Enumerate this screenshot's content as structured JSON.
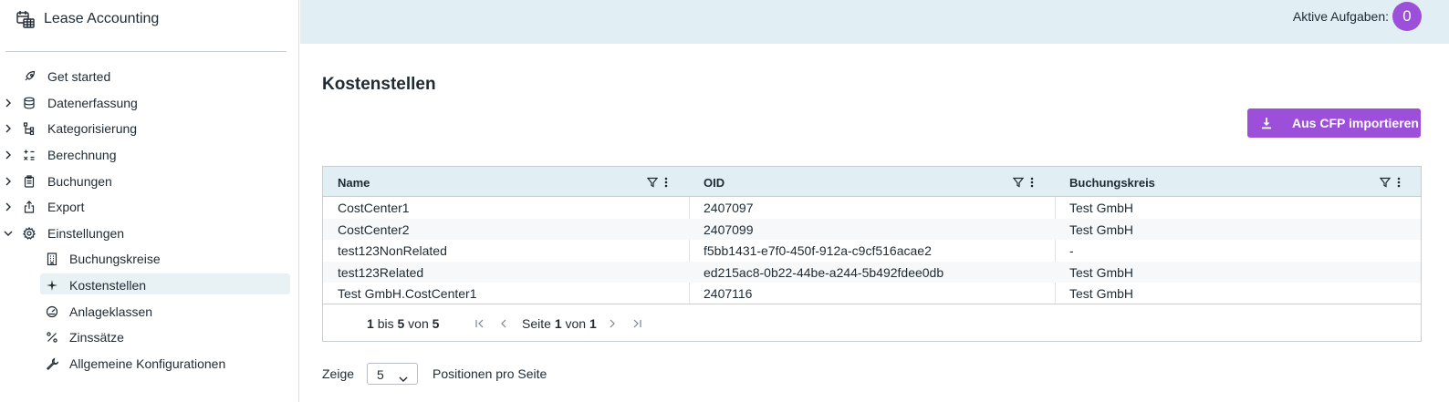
{
  "app": {
    "title": "Lease Accounting"
  },
  "sidebar": {
    "items": [
      {
        "label": "Get started",
        "icon": "rocket-icon"
      },
      {
        "label": "Datenerfassung",
        "icon": "database-icon"
      },
      {
        "label": "Kategorisierung",
        "icon": "hierarchy-icon"
      },
      {
        "label": "Berechnung",
        "icon": "calculator-icon"
      },
      {
        "label": "Buchungen",
        "icon": "clipboard-icon"
      },
      {
        "label": "Export",
        "icon": "export-icon"
      },
      {
        "label": "Einstellungen",
        "icon": "gear-icon"
      }
    ],
    "subitems": [
      {
        "label": "Buchungskreise",
        "icon": "building-icon"
      },
      {
        "label": "Kostenstellen",
        "icon": "sparkle-icon"
      },
      {
        "label": "Anlageklassen",
        "icon": "gauge-icon"
      },
      {
        "label": "Zinssätze",
        "icon": "percent-icon"
      },
      {
        "label": "Allgemeine Konfigurationen",
        "icon": "wrench-icon"
      }
    ]
  },
  "topbar": {
    "tasks_label": "Aktive Aufgaben:",
    "tasks_count": "0"
  },
  "page": {
    "title": "Kostenstellen",
    "import_label": "Aus CFP importieren"
  },
  "table": {
    "columns": [
      "Name",
      "OID",
      "Buchungskreis"
    ],
    "rows": [
      [
        "CostCenter1",
        "2407097",
        "Test GmbH"
      ],
      [
        "CostCenter2",
        "2407099",
        "Test GmbH"
      ],
      [
        "test123NonRelated",
        "f5bb1431-e7f0-450f-912a-c9cf516acae2",
        "-"
      ],
      [
        "test123Related",
        "ed215ac8-0b22-44be-a244-5b492fdee0db",
        "Test GmbH"
      ],
      [
        "Test GmbH.CostCenter1",
        "2407116",
        "Test GmbH"
      ]
    ]
  },
  "pager": {
    "from": "1",
    "bis": "bis",
    "to": "5",
    "von": "von",
    "total": "5",
    "seite": "Seite",
    "page": "1",
    "von2": "von",
    "pages": "1"
  },
  "page_size": {
    "label": "Zeige",
    "value": "5",
    "suffix": "Positionen pro Seite"
  },
  "colors": {
    "accent": "#9c4fd9",
    "topbar": "#e1eff5",
    "active": "#e8f1f4"
  }
}
